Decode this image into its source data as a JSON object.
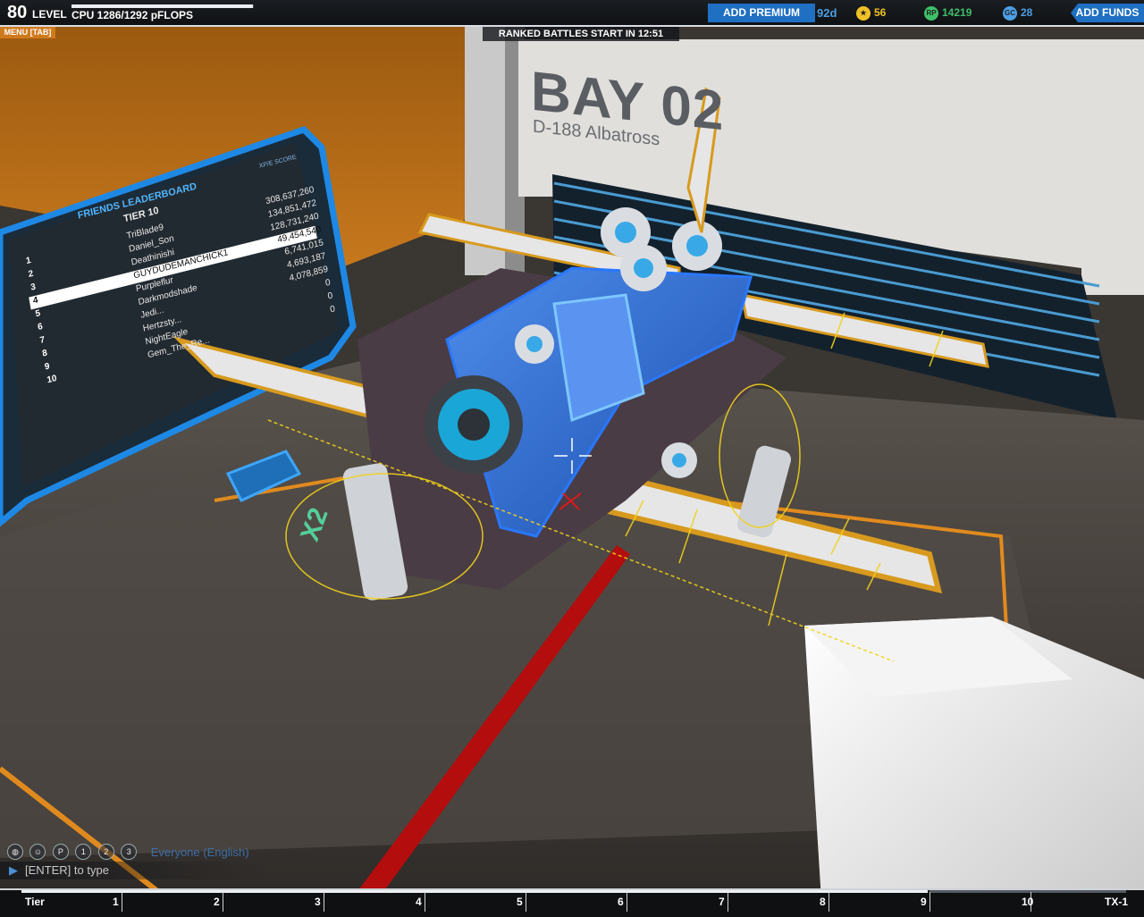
{
  "hud": {
    "level": "80",
    "level_label": "LEVEL",
    "cpu_text": "CPU 1286/1292 pFLOPS",
    "cpu_fraction": 0.995,
    "add_premium": "ADD PREMIUM",
    "premium_days": "92d",
    "currency": {
      "tier_points": "56",
      "robits": "14219",
      "galaxy_coins": "28"
    },
    "add_funds": "ADD FUNDS"
  },
  "menu_label": "MENU [TAB]",
  "ranked_banner": "RANKED BATTLES START IN 12:51",
  "bay": {
    "title": "BAY 02",
    "vehicle_name": "D-188 Albatross"
  },
  "leaderboard": {
    "title": "FRIENDS LEADERBOARD",
    "tier": "TIER 10",
    "header_right": "XP/E SCORE",
    "rows": [
      {
        "rank": "1",
        "name": "TriBlade9",
        "score": "308,637,260"
      },
      {
        "rank": "2",
        "name": "Daniel_Son",
        "score": "134,851,472"
      },
      {
        "rank": "3",
        "name": "Deathinishi",
        "score": "128,731,240"
      },
      {
        "rank": "4",
        "name": "GUYDUDEMANCHICK1",
        "score": "49,454,540",
        "highlight": true
      },
      {
        "rank": "5",
        "name": "Purpleflur",
        "score": "6,741,015"
      },
      {
        "rank": "6",
        "name": "Darkmodshade",
        "score": "4,693,187"
      },
      {
        "rank": "7",
        "name": "Jedi...",
        "score": "4,078,859"
      },
      {
        "rank": "8",
        "name": "Hertzsty...",
        "score": "0"
      },
      {
        "rank": "9",
        "name": "NightEagle",
        "score": "0"
      },
      {
        "rank": "10",
        "name": "Gem_The_Re...",
        "score": "0"
      }
    ]
  },
  "multiplier": "X2",
  "chat": {
    "channel": "Everyone (English)",
    "input_hint": "[ENTER] to type",
    "icons": [
      "globe-icon",
      "party-icon",
      "p-icon",
      "chat-1-icon",
      "chat-2-icon",
      "chat-3-icon"
    ]
  },
  "tierbar": {
    "start_label": "Tier",
    "end_label": "TX-1",
    "ticks": [
      "1",
      "2",
      "3",
      "4",
      "5",
      "6",
      "7",
      "8",
      "9",
      "10"
    ],
    "progress_fraction": 0.82
  },
  "colors": {
    "accent_blue": "#1f6fc2",
    "accent_orange": "#d07a1e",
    "robits_green": "#3fbf6a"
  }
}
